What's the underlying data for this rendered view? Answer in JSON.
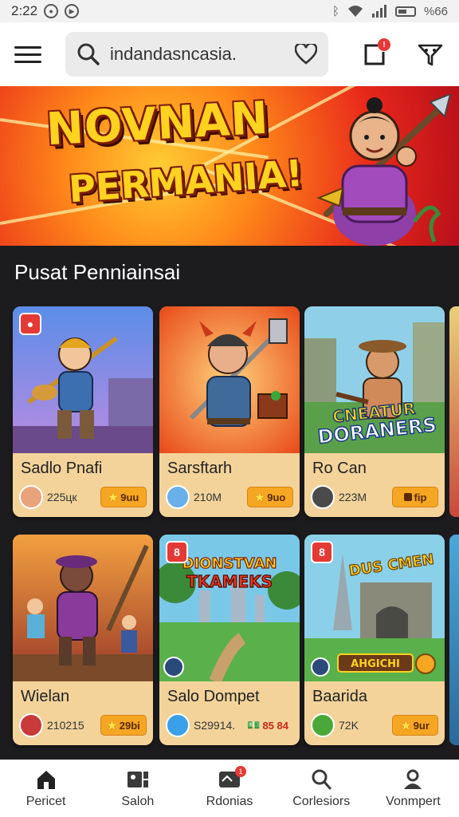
{
  "status_bar": {
    "time": "2:22",
    "battery": "%66"
  },
  "search": {
    "value": "indandasncasia."
  },
  "notifications": {
    "badge": "!"
  },
  "banner": {
    "title": "NOVNAN",
    "subtitle": "PERMANIA!"
  },
  "section": {
    "title": "Pusat Penniainsai"
  },
  "cards": [
    {
      "title": "Sadlo Pnafi",
      "count": "225цк",
      "pill": "9uu",
      "badge": ""
    },
    {
      "title": "Sarsftarh",
      "count": "210M",
      "pill": "9uo",
      "badge": ""
    },
    {
      "title": "Ro Can",
      "count": "223M",
      "pill": "fip",
      "badge": "",
      "art_text": [
        "CNEATUR",
        "DORANERS"
      ]
    },
    {
      "title": "Wielan",
      "count": "210215",
      "pill": "29bi",
      "badge": ""
    },
    {
      "title": "Salo Dompet",
      "count": "S29914.",
      "pill": "85 84",
      "badge": "8",
      "art_text": [
        "DIONSTVAN",
        "TKAMEKS"
      ]
    },
    {
      "title": "Baarida",
      "count": "72K",
      "pill": "9ur",
      "badge": "8",
      "art_text": [
        "DUS CMEN",
        "AHGICHI"
      ]
    }
  ],
  "bottom_nav": [
    {
      "label": "Pericet",
      "icon": "home-icon"
    },
    {
      "label": "Saloh",
      "icon": "gallery-icon"
    },
    {
      "label": "Rdonias",
      "icon": "inbox-icon",
      "badge": "1"
    },
    {
      "label": "Corlesiors",
      "icon": "search-icon"
    },
    {
      "label": "Vonmpert",
      "icon": "profile-icon"
    }
  ],
  "colors": {
    "accent": "#e53935",
    "card": "#f3d39a",
    "pill": "#f5a623",
    "background": "#1c1c1e"
  }
}
